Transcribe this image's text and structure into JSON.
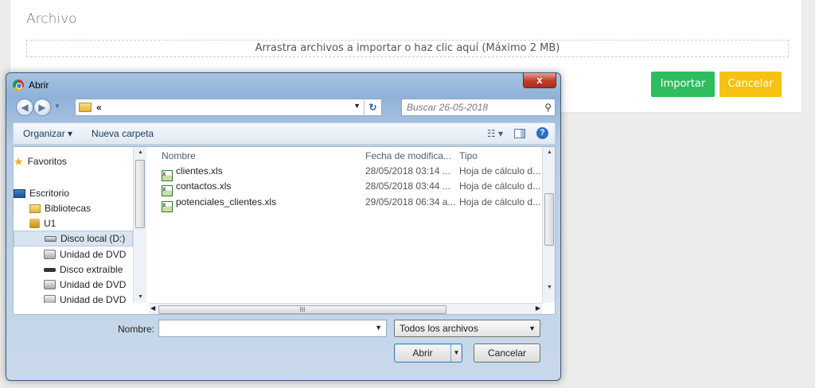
{
  "page": {
    "card_title": "Archivo",
    "dropzone_text": "Arrastra archivos a importar o haz clic aquí (Máximo 2 MB)",
    "import_label": "Importar",
    "cancel_label": "Cancelar",
    "colors": {
      "import": "#2ebd5e",
      "cancel": "#f5c211"
    }
  },
  "dialog": {
    "title": "Abrir",
    "close_symbol": "x",
    "address_text": "«",
    "search_placeholder": "Buscar 26-05-2018",
    "toolbar": {
      "organize": "Organizar ▾",
      "new_folder": "Nueva carpeta"
    },
    "nav_items": [
      {
        "label": "Favoritos",
        "icon": "star-icon"
      },
      {
        "label": "Escritorio",
        "icon": "desktop-icon"
      },
      {
        "label": "Bibliotecas",
        "icon": "library-icon"
      },
      {
        "label": "U1",
        "icon": "user-icon"
      },
      {
        "label": "Disco local (D:)",
        "icon": "drive-icon",
        "selected": true
      },
      {
        "label": "Unidad de DVD",
        "icon": "dvd-icon"
      },
      {
        "label": "Disco extraíble",
        "icon": "removable-drive-icon"
      },
      {
        "label": "Unidad de DVD",
        "icon": "dvd-icon"
      },
      {
        "label": "Unidad de DVD",
        "icon": "dvd-icon"
      }
    ],
    "columns": {
      "name": "Nombre",
      "date": "Fecha de modifica...",
      "type": "Tipo"
    },
    "files": [
      {
        "name": "clientes.xls",
        "date": "28/05/2018 03:14 ...",
        "type": "Hoja de cálculo d..."
      },
      {
        "name": "contactos.xls",
        "date": "28/05/2018 03:44 ...",
        "type": "Hoja de cálculo d..."
      },
      {
        "name": "potenciales_clientes.xls",
        "date": "29/05/2018 06:34 a...",
        "type": "Hoja de cálculo d..."
      }
    ],
    "filename_label": "Nombre:",
    "filename_value": "",
    "filetype_value": "Todos los archivos",
    "open_label": "Abrir",
    "cancel_label": "Cancelar",
    "hscroll_grip": "III"
  }
}
